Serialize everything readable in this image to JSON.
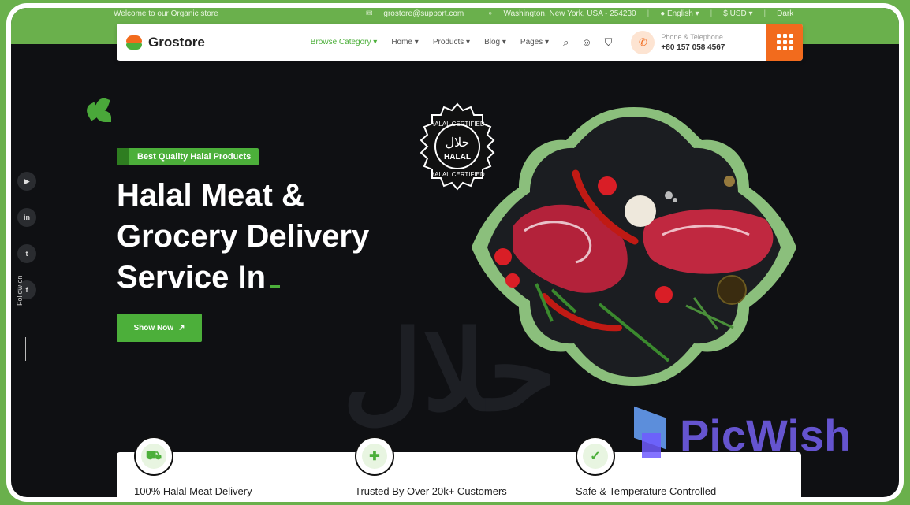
{
  "topbar": {
    "welcome": "Welcome to our Organic store",
    "email": "grostore@support.com",
    "address": "Washington, New York, USA - 254230",
    "language": "English",
    "currency": "$ USD",
    "mode": "Dark"
  },
  "nav": {
    "brand": "Grostore",
    "menu": [
      "Browse Category",
      "Home",
      "Products",
      "Blog",
      "Pages"
    ],
    "phone_label": "Phone & Telephone",
    "phone_number": "+80 157 058 4567"
  },
  "hero": {
    "badge": "Best Quality Halal Products",
    "headline_1": "Halal Meat &",
    "headline_2": "Grocery Delivery",
    "headline_3": "Service In",
    "cta": "Show Now",
    "seal_top": "HALAL CERTIFIED",
    "seal_mid": "HALAL",
    "seal_bottom": "HALAL CERTIFIED",
    "ghost_text": "حلال"
  },
  "social": {
    "follow": "Follow on",
    "items": [
      "youtube",
      "linkedin",
      "twitter",
      "facebook"
    ]
  },
  "features": [
    {
      "label": "100% Halal Meat Delivery",
      "icon": "meat-icon"
    },
    {
      "label": "Trusted By Over 20k+ Customers",
      "icon": "customers-icon"
    },
    {
      "label": "Safe & Temperature Controlled",
      "icon": "shield-icon"
    }
  ],
  "watermark": "PicWish",
  "colors": {
    "accent": "#4caf3a",
    "orange": "#f26b1d",
    "dark": "#0f1013",
    "frame": "#6ab04c"
  }
}
